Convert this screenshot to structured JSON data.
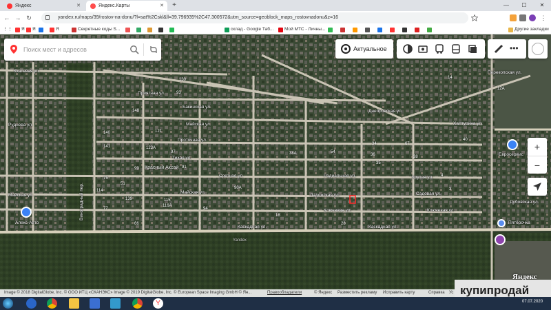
{
  "browser": {
    "tabs": [
      {
        "label": "Яндекс",
        "active": false
      },
      {
        "label": "Яндекс.Карты",
        "active": true
      }
    ],
    "url": "yandex.ru/maps/39/rostov-na-donu/?l=sat%2Cskl&ll=39.796935%2C47.300572&utm_source=geoblock_maps_rostovnadonu&z=16",
    "bookmarks": [
      "Я",
      "Я",
      "",
      "Я",
      "Секретные коды S...",
      "",
      "",
      "",
      "",
      "",
      "склад - Google Таб...",
      "Мой МТС - Личны...",
      "",
      "",
      "",
      "",
      "",
      "",
      "",
      "",
      "Другие закладки"
    ]
  },
  "map": {
    "search": {
      "placeholder": "Поиск мест и адресов"
    },
    "actual_label": "Актуальное",
    "districts": [
      "Красный Аксай"
    ],
    "streets": [
      "Кхатевая ул.",
      "Виноградный пер.",
      "Приятная ул.",
      "Бакинская ул.",
      "Майская ул.",
      "Проточная ул.",
      "Тихая ул.",
      "Сретная ул.",
      "Радиальная ул.",
      "Майская ул.",
      "Ладожская ул.",
      "Каскадная ул.",
      "Каскадная ул.",
      "Садовая ул.",
      "Ключевая ул.",
      "Днепровская ул.",
      "Халтурина ул.",
      "Перекопская ул.",
      "Дубовская ул.",
      "Руднева ул.",
      "Ключевая ул.",
      "Майская ул.",
      "Крутая ул."
    ],
    "poi": [
      "Пятёрочка",
      "Евросервис",
      "Алекс-Авто"
    ],
    "numbers": [
      "130",
      "148",
      "93",
      "121",
      "140",
      "141",
      "97",
      "123А",
      "91",
      "54",
      "94",
      "38А",
      "99",
      "51",
      "90А",
      "114",
      "115",
      "139",
      "116А",
      "77",
      "18",
      "28",
      "66",
      "75",
      "34",
      "35",
      "36",
      "38",
      "14",
      "12А",
      "40",
      "67",
      "4",
      "3"
    ],
    "copyright_left": "Image © 2018 DigitalGlobe, Inc. © ООО ИТЦ «СКАНЭКС» Image © 2019 DigitalGlobe, Inc. © European Space Imaging GmbH © Ян...",
    "copyright_links": [
      "Правообладатели",
      "© Яндекс",
      "Разместить рекламу",
      "Исправить карту",
      "Справка",
      "Ус"
    ],
    "logo": "Яндекс",
    "area_label": "Yandex"
  },
  "watermark": "купипродай",
  "taskbar": {
    "time": "07.07.2020"
  },
  "colors": {
    "accent": "#ff3333",
    "road": "#c9c3b4",
    "forest": "#2e3f24"
  }
}
